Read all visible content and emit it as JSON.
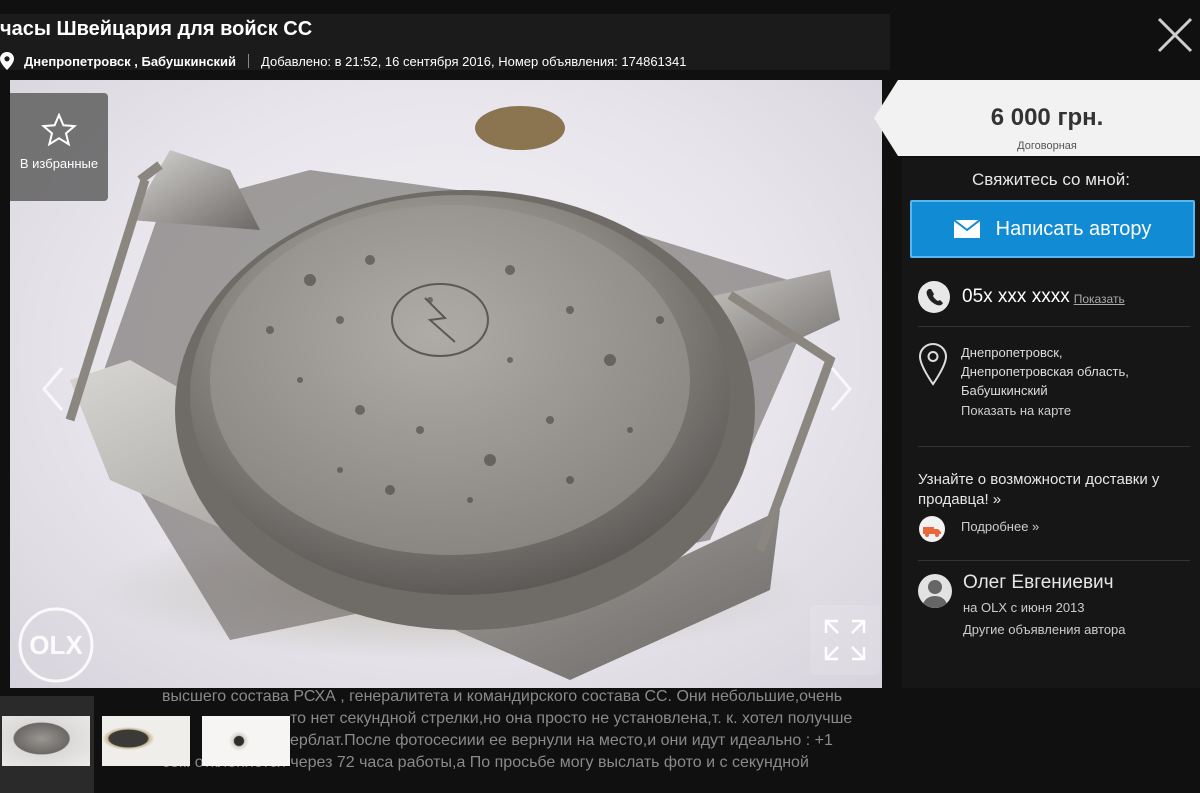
{
  "header": {
    "title": "часы Швейцария для войск СС",
    "location": "Днепропетровск , Бабушкинский",
    "added": "Добавлено: в 21:52, 16 сентября 2016, Номер объявления: 174861341"
  },
  "favorite": {
    "label": "В избранные"
  },
  "price": {
    "value": "6 000 грн.",
    "note": "Договорная"
  },
  "contact": {
    "heading": "Свяжитесь со мной:",
    "write_label": "Написать автору",
    "phone": "05x xxx xxxx",
    "show_label": "Показать"
  },
  "address": {
    "line1": "Днепропетровск,",
    "line2": "Днепропетровская область,",
    "line3": "Бабушкинский",
    "map_link": "Показать на карте"
  },
  "delivery": {
    "text": "Узнайте о возможности доставки у продавца! »",
    "more": "Подробнее »"
  },
  "seller": {
    "name": "Олег Евгениевич",
    "since": "на OLX с июня 2013",
    "other_ads": "Другие объявления автора"
  },
  "description_lines": [
    "высшего состава РСХА , генералитета и командирского состава СС. Они небольшие,очень",
    "то нет секундной стрелки,но она просто не установлена,т. к. хотел получше",
    "ерблат.После фотосесиии ее вернули на место,и они идут идеально : +1",
    "сек. отклоняется через 72 часа работы,а По просьбе могу выслать фото и с секундной"
  ],
  "watermark": "OLX",
  "icons": [
    "pin-icon",
    "close-icon",
    "star-icon",
    "chevron-left-icon",
    "chevron-right-icon",
    "fullscreen-icon",
    "envelope-icon",
    "phone-icon",
    "map-pin-icon",
    "delivery-icon",
    "user-icon"
  ],
  "colors": {
    "accent": "#128bd5",
    "price_bg": "#f2f2f2",
    "panel_bg": "#161616"
  }
}
